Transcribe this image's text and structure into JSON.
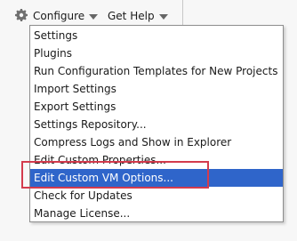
{
  "top_bar": {
    "configure_label": "Configure",
    "get_help_label": "Get Help"
  },
  "icons": {
    "settings": "gear-icon",
    "menu_caret": "chevron-down-icon"
  },
  "menu": {
    "items": [
      "Settings",
      "Plugins",
      "Run Configuration Templates for New Projects",
      "Import Settings",
      "Export Settings",
      "Settings Repository...",
      "Compress Logs and Show in Explorer",
      "Edit Custom Properties...",
      "Edit Custom VM Options...",
      "Check for Updates",
      "Manage License..."
    ],
    "selected_index": 8
  },
  "colors": {
    "selection": "#2f65ca",
    "highlight_outline": "#d33b4d"
  }
}
